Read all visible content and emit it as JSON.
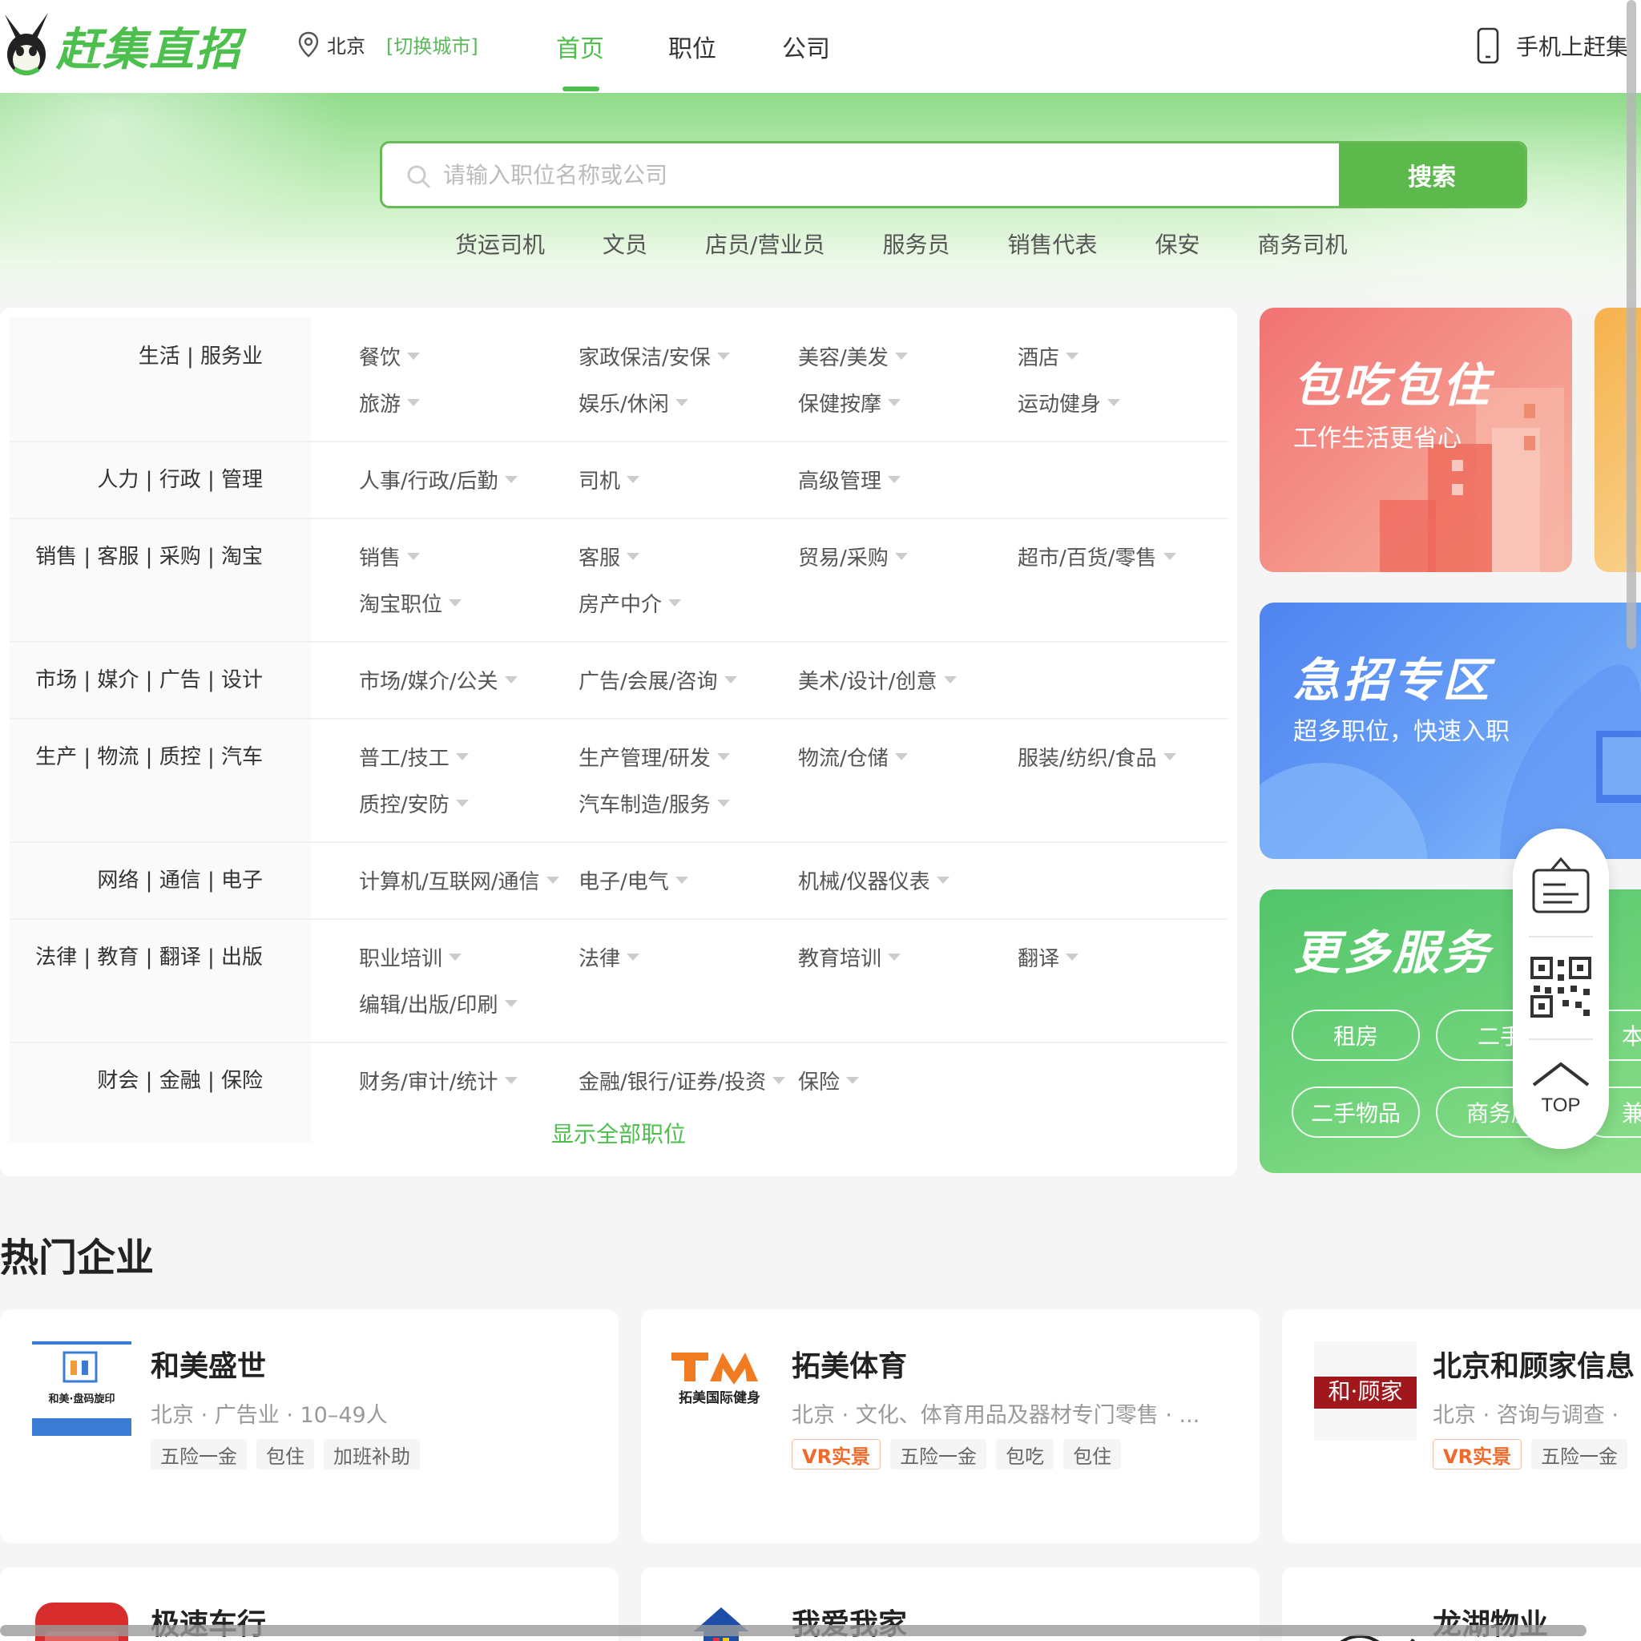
{
  "header": {
    "logo_text": "赶集直招",
    "city": "北京",
    "city_switch": "[切换城市]",
    "nav": [
      "首页",
      "职位",
      "公司"
    ],
    "mobile_label": "手机上赶集"
  },
  "search": {
    "placeholder": "请输入职位名称或公司",
    "button": "搜索",
    "hot_tags": [
      "货运司机",
      "文员",
      "店员/营业员",
      "服务员",
      "销售代表",
      "保安",
      "商务司机"
    ]
  },
  "categories": [
    {
      "name": "生活 | 服务业",
      "subs": [
        "餐饮",
        "家政保洁/安保",
        "美容/美发",
        "酒店",
        "旅游",
        "娱乐/休闲",
        "保健按摩",
        "运动健身"
      ]
    },
    {
      "name": "人力 | 行政 | 管理",
      "subs": [
        "人事/行政/后勤",
        "司机",
        "高级管理"
      ]
    },
    {
      "name": "销售 | 客服 | 采购 | 淘宝",
      "subs": [
        "销售",
        "客服",
        "贸易/采购",
        "超市/百货/零售",
        "淘宝职位",
        "房产中介"
      ]
    },
    {
      "name": "市场 | 媒介 | 广告 | 设计",
      "subs": [
        "市场/媒介/公关",
        "广告/会展/咨询",
        "美术/设计/创意"
      ]
    },
    {
      "name": "生产 | 物流 | 质控 | 汽车",
      "subs": [
        "普工/技工",
        "生产管理/研发",
        "物流/仓储",
        "服装/纺织/食品",
        "质控/安防",
        "汽车制造/服务"
      ]
    },
    {
      "name": "网络 | 通信 | 电子",
      "subs": [
        "计算机/互联网/通信",
        "电子/电气",
        "机械/仪器仪表"
      ]
    },
    {
      "name": "法律 | 教育 | 翻译 | 出版",
      "subs": [
        "职业培训",
        "法律",
        "教育培训",
        "翻译",
        "编辑/出版/印刷"
      ]
    },
    {
      "name": "财会 | 金融 | 保险",
      "subs": [
        "财务/审计/统计",
        "金融/银行/证券/投资",
        "保险"
      ]
    }
  ],
  "show_all": "显示全部职位",
  "banners": {
    "b1_title": "包吃包住",
    "b1_sub": "工作生活更省心",
    "b2_title": "急招专区",
    "b2_sub": "超多职位，快速入职",
    "b3_title": "更多服务",
    "services": [
      "租房",
      "二手",
      "本地",
      "二手物品",
      "商务服",
      "兼职"
    ]
  },
  "float_tool": {
    "top_label": "TOP"
  },
  "hot_companies": {
    "title": "热门企业",
    "cards": [
      {
        "name": "和美盛世",
        "meta": "北京 · 广告业 · 10–49人",
        "tags": [
          "五险一金",
          "包住",
          "加班补助"
        ],
        "vr": false,
        "logo_text": "和美·盘码旋印"
      },
      {
        "name": "拓美体育",
        "meta": "北京 · 文化、体育用品及器材专门零售 · ...",
        "tags": [
          "五险一金",
          "包吃",
          "包住"
        ],
        "vr": true,
        "vr_label": "VR实景",
        "logo_text": "拓美国际健身"
      },
      {
        "name": "北京和顾家信息",
        "meta": "北京 · 咨询与调查 · ",
        "tags": [
          "五险一金"
        ],
        "vr": true,
        "vr_label": "VR实景",
        "logo_text": "和·顾家"
      }
    ],
    "cards_row2": [
      "极速车行",
      "我爱我家",
      "龙湖物业"
    ]
  },
  "colors": {
    "brand_green": "#4cbf4c",
    "search_green": "#5cb94b",
    "vr_orange": "#ef6b2c"
  }
}
